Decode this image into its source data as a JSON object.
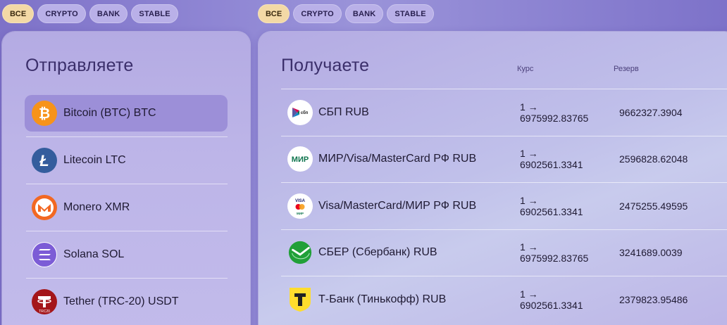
{
  "filters_left": [
    "ВСЕ",
    "CRYPTO",
    "BANK",
    "STABLE"
  ],
  "filters_right": [
    "ВСЕ",
    "CRYPTO",
    "BANK",
    "STABLE"
  ],
  "send": {
    "title": "Отправляете",
    "items": [
      {
        "label": "Bitcoin (BTC) BTC",
        "icon": "bitcoin-icon",
        "selected": true
      },
      {
        "label": "Litecoin LTC",
        "icon": "litecoin-icon",
        "selected": false
      },
      {
        "label": "Monero XMR",
        "icon": "monero-icon",
        "selected": false
      },
      {
        "label": "Solana SOL",
        "icon": "solana-icon",
        "selected": false
      },
      {
        "label": "Tether (TRC-20) USDT",
        "icon": "tether-icon",
        "selected": false
      }
    ]
  },
  "receive": {
    "title": "Получаете",
    "headers": {
      "rate": "Курс",
      "reserve": "Резерв"
    },
    "rows": [
      {
        "name": "СБП RUB",
        "rate_line1": "1 →",
        "rate_line2": "6975992.83765",
        "reserve": "9662327.3904",
        "icon": "sbp-icon"
      },
      {
        "name": "МИР/Visa/MasterCard РФ RUB",
        "rate_line1": "1 →",
        "rate_line2": "6902561.3341",
        "reserve": "2596828.62048",
        "icon": "mir-icon"
      },
      {
        "name": "Visa/MasterCard/МИР РФ RUB",
        "rate_line1": "1 →",
        "rate_line2": "6902561.3341",
        "reserve": "2475255.49595",
        "icon": "visa-mastercard-icon"
      },
      {
        "name": "СБЕР (Сбербанк) RUB",
        "rate_line1": "1 →",
        "rate_line2": "6975992.83765",
        "reserve": "3241689.0039",
        "icon": "sber-icon"
      },
      {
        "name": "Т-Банк (Тинькофф) RUB",
        "rate_line1": "1 →",
        "rate_line2": "6902561.3341",
        "reserve": "2379823.95486",
        "icon": "tbank-icon"
      }
    ]
  },
  "colors": {
    "chip_active": "#f3d9a6",
    "chip_default": "#b9b0e8",
    "selected_item": "#9c8fd8",
    "bitcoin": "#f7931a",
    "litecoin": "#345d9d",
    "monero": "#f26822",
    "tether": "#a4161a",
    "sber": "#21a038",
    "tbank": "#ffdd2d"
  },
  "icon_text": {
    "sbp_logo": "сбп",
    "mir_logo": "МИР",
    "visa_logo": "VISA",
    "mir_small": "МИР",
    "tether_logo": "TRC20"
  }
}
